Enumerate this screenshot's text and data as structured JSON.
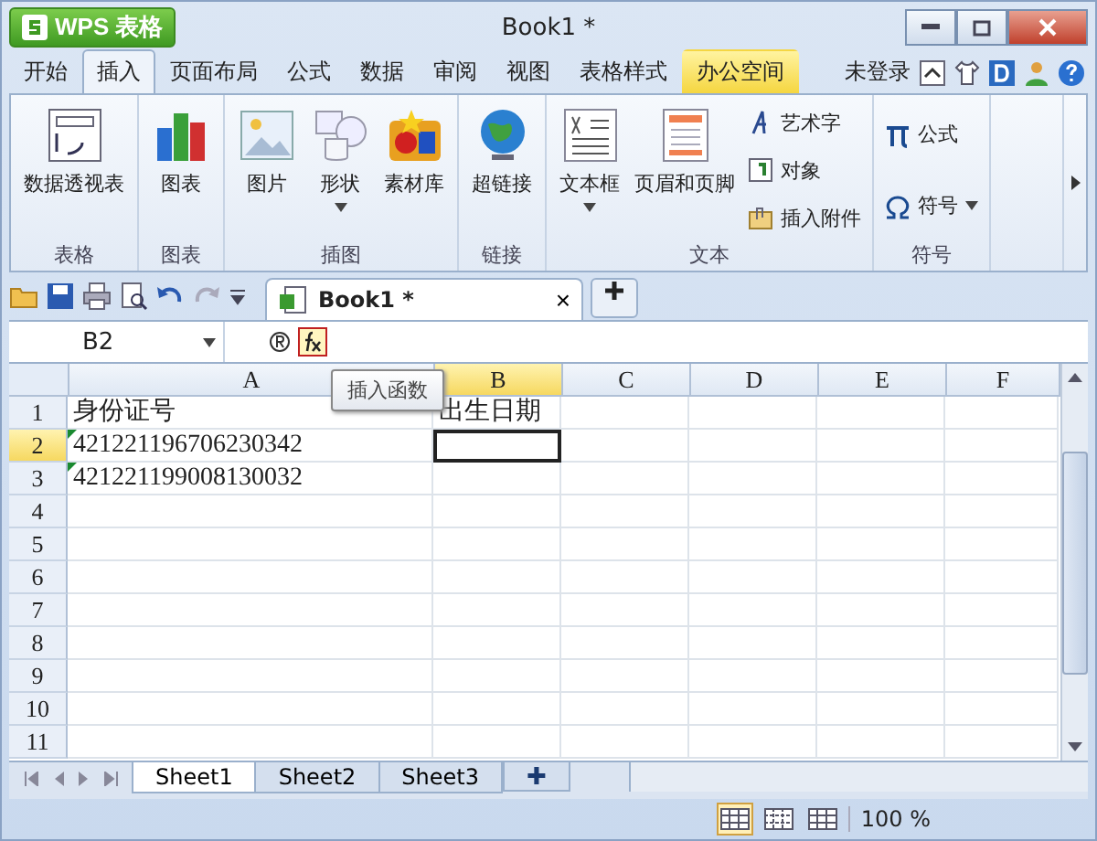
{
  "app_button": {
    "label": "WPS 表格"
  },
  "window": {
    "title": "Book1 *"
  },
  "menu_tabs": [
    {
      "label": "开始",
      "selected": false,
      "kind": "normal"
    },
    {
      "label": "插入",
      "selected": true,
      "kind": "normal"
    },
    {
      "label": "页面布局",
      "selected": false,
      "kind": "normal"
    },
    {
      "label": "公式",
      "selected": false,
      "kind": "normal"
    },
    {
      "label": "数据",
      "selected": false,
      "kind": "normal"
    },
    {
      "label": "审阅",
      "selected": false,
      "kind": "normal"
    },
    {
      "label": "视图",
      "selected": false,
      "kind": "normal"
    },
    {
      "label": "表格样式",
      "selected": false,
      "kind": "normal"
    },
    {
      "label": "办公空间",
      "selected": false,
      "kind": "highlight"
    }
  ],
  "login": {
    "label": "未登录"
  },
  "ribbon_groups": [
    {
      "label": "表格",
      "items": [
        {
          "label": "数据透视表",
          "kind": "large",
          "dropdown": false
        }
      ]
    },
    {
      "label": "图表",
      "items": [
        {
          "label": "图表",
          "kind": "large",
          "dropdown": false
        }
      ]
    },
    {
      "label": "插图",
      "items": [
        {
          "label": "图片",
          "kind": "large",
          "dropdown": false
        },
        {
          "label": "形状",
          "kind": "large",
          "dropdown": true
        },
        {
          "label": "素材库",
          "kind": "large",
          "dropdown": false
        }
      ]
    },
    {
      "label": "链接",
      "items": [
        {
          "label": "超链接",
          "kind": "large",
          "dropdown": false
        }
      ]
    },
    {
      "label": "文本",
      "items": [
        {
          "label": "文本框",
          "kind": "large",
          "dropdown": true
        },
        {
          "label": "页眉和页脚",
          "kind": "large",
          "dropdown": false
        },
        {
          "label": "艺术字",
          "kind": "small",
          "dropdown": false
        },
        {
          "label": "对象",
          "kind": "small",
          "dropdown": false
        },
        {
          "label": "插入附件",
          "kind": "small",
          "dropdown": false
        }
      ]
    },
    {
      "label": "符号",
      "items": [
        {
          "label": "公式",
          "kind": "small",
          "dropdown": false
        },
        {
          "label": "符号",
          "kind": "small",
          "dropdown": true
        }
      ]
    }
  ],
  "doc_tab": {
    "title": "Book1 *",
    "close": "×"
  },
  "formula_bar": {
    "cell_ref": "B2",
    "tooltip": "插入函数"
  },
  "columns": [
    {
      "label": "A",
      "selected": false
    },
    {
      "label": "B",
      "selected": true
    },
    {
      "label": "C",
      "selected": false
    },
    {
      "label": "D",
      "selected": false
    },
    {
      "label": "E",
      "selected": false
    },
    {
      "label": "F",
      "selected": false
    }
  ],
  "rows": [
    {
      "label": "1",
      "selected": false,
      "cells": [
        {
          "text": "身份证号",
          "warning": false
        },
        {
          "text": "出生日期",
          "warning": false
        }
      ]
    },
    {
      "label": "2",
      "selected": true,
      "cells": [
        {
          "text": "421221196706230342",
          "warning": true
        }
      ]
    },
    {
      "label": "3",
      "selected": false,
      "cells": [
        {
          "text": "421221199008130032",
          "warning": true
        }
      ]
    },
    {
      "label": "4",
      "selected": false,
      "cells": []
    },
    {
      "label": "5",
      "selected": false,
      "cells": []
    },
    {
      "label": "6",
      "selected": false,
      "cells": []
    },
    {
      "label": "7",
      "selected": false,
      "cells": []
    },
    {
      "label": "8",
      "selected": false,
      "cells": []
    },
    {
      "label": "9",
      "selected": false,
      "cells": []
    },
    {
      "label": "10",
      "selected": false,
      "cells": []
    },
    {
      "label": "11",
      "selected": false,
      "cells": []
    }
  ],
  "sheet_tabs": [
    {
      "label": "Sheet1",
      "selected": true
    },
    {
      "label": "Sheet2",
      "selected": false
    },
    {
      "label": "Sheet3",
      "selected": false
    }
  ],
  "add_sheet": "✚",
  "status_bar": {
    "view_modes": [
      {
        "selected": true
      },
      {
        "selected": false
      },
      {
        "selected": false
      }
    ],
    "zoom": "100 %"
  }
}
